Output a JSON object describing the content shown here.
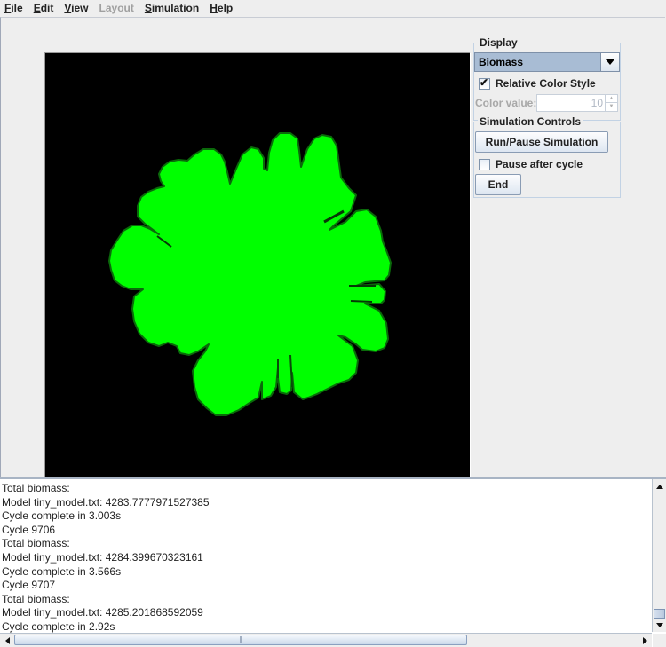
{
  "menubar": {
    "items": [
      {
        "label": "File",
        "mnemonic": "F",
        "rest": "ile",
        "enabled": true
      },
      {
        "label": "Edit",
        "mnemonic": "E",
        "rest": "dit",
        "enabled": true
      },
      {
        "label": "View",
        "mnemonic": "V",
        "rest": "iew",
        "enabled": true
      },
      {
        "label": "Layout",
        "mnemonic": "",
        "rest": "Layout",
        "enabled": false
      },
      {
        "label": "Simulation",
        "mnemonic": "S",
        "rest": "imulation",
        "enabled": true
      },
      {
        "label": "Help",
        "mnemonic": "H",
        "rest": "elp",
        "enabled": true
      }
    ]
  },
  "canvas": {
    "background_color": "#000000",
    "colony_color": "#00ff00",
    "colony_edge_color": "#006400"
  },
  "display_panel": {
    "title": "Display",
    "dropdown_value": "Biomass",
    "relative_color_label": "Relative Color Style",
    "relative_color_checked": true,
    "check_glyph": "✔",
    "color_value_label": "Color value:",
    "color_value": "10",
    "color_value_enabled": false
  },
  "sim_panel": {
    "title": "Simulation Controls",
    "run_pause_label": "Run/Pause Simulation",
    "pause_after_cycle_label": "Pause after cycle",
    "pause_after_cycle_checked": false,
    "end_label": "End"
  },
  "console": {
    "lines": [
      "Total biomass:",
      "Model tiny_model.txt: 4283.7777971527385",
      "Cycle complete in 3.003s",
      "Cycle 9706",
      "Total biomass:",
      "Model tiny_model.txt: 4284.399670323161",
      "Cycle complete in 3.566s",
      "Cycle 9707",
      "Total biomass:",
      "Model tiny_model.txt: 4285.201868592059",
      "Cycle complete in 2.92s"
    ],
    "vertical_scroll_position": 0.95,
    "horizontal_scroll_grip": "|||"
  }
}
